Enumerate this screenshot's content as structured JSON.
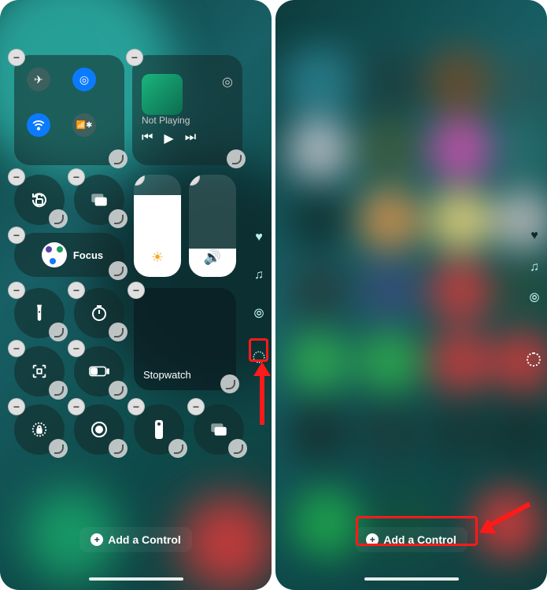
{
  "left": {
    "media": {
      "title": "Not Playing"
    },
    "focus_label": "Focus",
    "stopwatch_label": "Stopwatch",
    "add_control_label": "Add a Control"
  },
  "right": {
    "add_control_label": "Add a Control"
  },
  "colors": {
    "accent_blue": "#0a7bff",
    "annotation_red": "#ff1a1a"
  }
}
